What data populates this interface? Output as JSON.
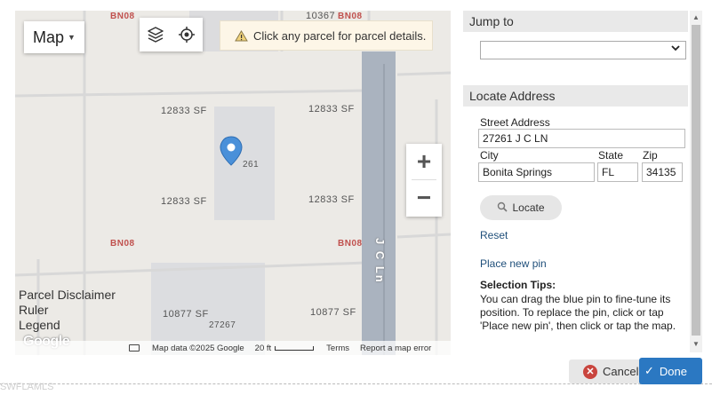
{
  "map": {
    "map_type_label": "Map",
    "layers_icon": "layers-icon",
    "locate_icon": "crosshair-icon",
    "hint_text": "Click any parcel for parcel details.",
    "zoom_in": "+",
    "zoom_out": "−",
    "parcel_labels": [
      "BN08",
      "10367",
      "BN08",
      "12833 SF",
      "12833 SF",
      "261",
      "12833 SF",
      "12833 SF",
      "BN08",
      "BN08",
      "10877 SF",
      "27267",
      "10877 SF"
    ],
    "road_name": "J C Ln",
    "links": [
      "Parcel Disclaimer",
      "Ruler",
      "Legend"
    ],
    "google_logo": "Google",
    "attribution": {
      "map_data": "Map data ©2025 Google",
      "scale": "20 ft",
      "terms": "Terms",
      "report": "Report a map error"
    }
  },
  "panel": {
    "jump_to": {
      "heading": "Jump to",
      "selected": ""
    },
    "locate_address": {
      "heading": "Locate Address",
      "street_label": "Street Address",
      "street_value": "27261 J C LN",
      "city_label": "City",
      "city_value": "Bonita Springs",
      "state_label": "State",
      "state_value": "FL",
      "zip_label": "Zip",
      "zip_value": "34135",
      "locate_button": "Locate",
      "reset_link": "Reset",
      "place_pin_link": "Place new pin"
    },
    "tips": {
      "title": "Selection Tips:",
      "body": "You can drag the blue pin to fine-tune its position. To replace the pin, click or tap 'Place new pin', then click or tap the map."
    }
  },
  "footer": {
    "cancel": "Cancel",
    "done": "Done",
    "watermark": "SWFLAMLS"
  },
  "colors": {
    "accent": "#2b78c2",
    "cancel_icon": "#c9453e",
    "zone_label": "#c0504d",
    "road": "#aab3bf",
    "pin": "#4a90d9"
  }
}
